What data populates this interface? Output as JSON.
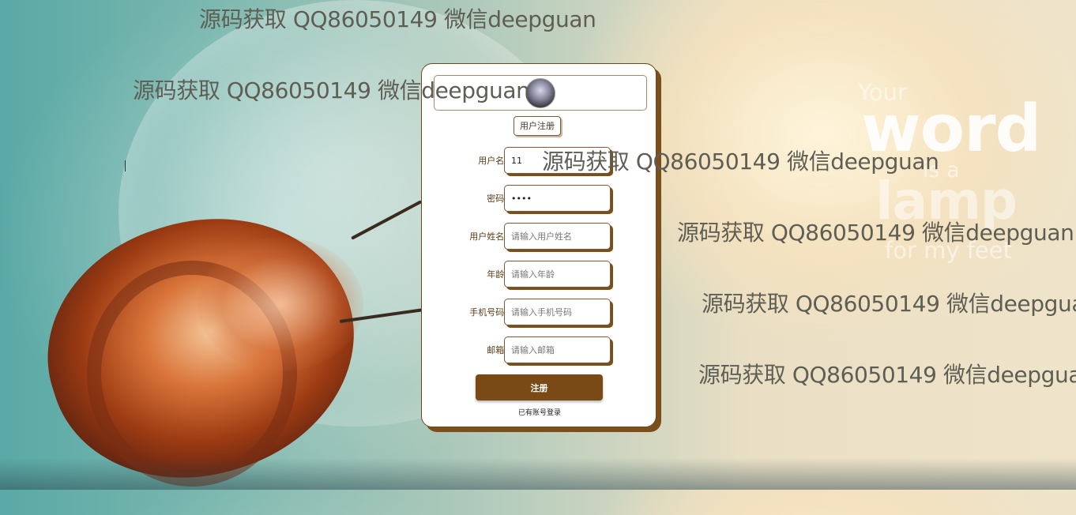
{
  "watermarks": [
    "源码获取 QQ86050149 微信deepguan",
    "源码获取 QQ86050149 微信deepguan",
    "源码获取 QQ86050149 微信deepguan",
    "源码获取 QQ86050149 微信deepguan",
    "源码获取 QQ86050149 微信deepguan",
    "源码获取 QQ86050149 微信deepguan"
  ],
  "background_quote": {
    "line1": "Your",
    "line2": "word",
    "line3": "is a",
    "line4": "lamp",
    "line5": "for my feet"
  },
  "form": {
    "badge": "用户注册",
    "fields": [
      {
        "label": "用户名:",
        "value": "11",
        "placeholder": ""
      },
      {
        "label": "密码:",
        "value": "••••",
        "placeholder": ""
      },
      {
        "label": "用户姓名:",
        "value": "",
        "placeholder": "请输入用户姓名"
      },
      {
        "label": "年龄:",
        "value": "",
        "placeholder": "请输入年龄"
      },
      {
        "label": "手机号码:",
        "value": "",
        "placeholder": "请输入手机号码"
      },
      {
        "label": "邮箱:",
        "value": "",
        "placeholder": "请输入邮箱"
      }
    ],
    "submit_label": "注册",
    "login_link": "已有账号登录"
  },
  "colors": {
    "accent": "#7a4a16",
    "label": "#5a3b17",
    "watermark": "#5e5e54"
  }
}
